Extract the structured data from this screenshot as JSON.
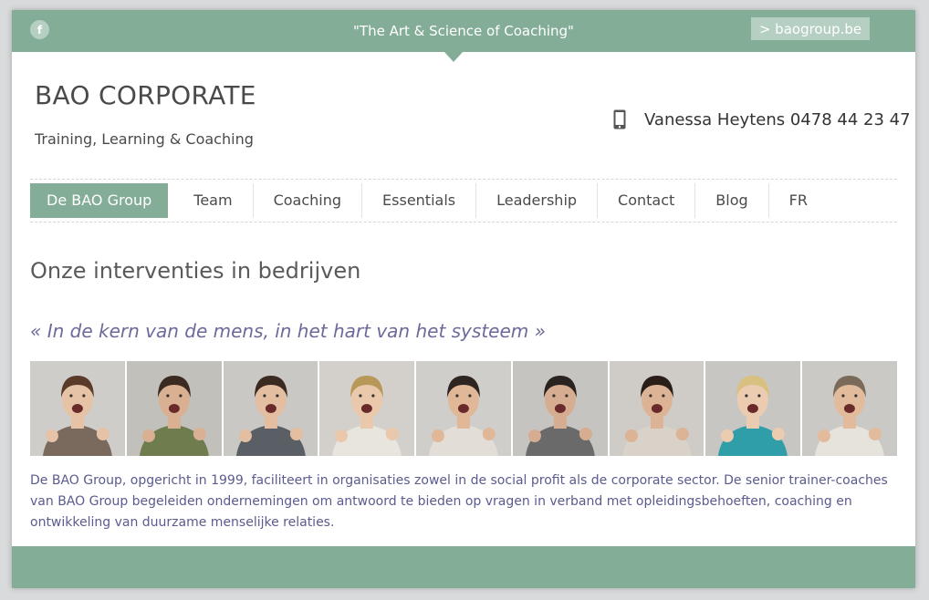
{
  "topbar": {
    "social_icon": "facebook-icon",
    "social_letter": "f",
    "tagline": "\"The Art & Science of Coaching\"",
    "external_link": "> baogroup.be"
  },
  "header": {
    "brand": "BAO CORPORATE",
    "subtitle": "Training, Learning & Coaching",
    "phone_icon": "mobile-phone-icon",
    "contact": "Vanessa Heytens 0478 44 23 47"
  },
  "nav": {
    "items": [
      {
        "label": "De BAO Group",
        "active": true
      },
      {
        "label": "Team"
      },
      {
        "label": "Coaching"
      },
      {
        "label": "Essentials"
      },
      {
        "label": "Leadership"
      },
      {
        "label": "Contact"
      },
      {
        "label": "Blog"
      },
      {
        "label": "FR"
      }
    ]
  },
  "main": {
    "heading": "Onze interventies in bedrijven",
    "quote": "« In de kern van de mens, in het hart van het systeem »",
    "photos": [
      {
        "shirt": "#7a6a5e",
        "hair": "#5a3a28",
        "bg": "#cfcdca"
      },
      {
        "shirt": "#6e7c4e",
        "hair": "#3a2a22",
        "bg": "#c2c0bb"
      },
      {
        "shirt": "#5a5f66",
        "hair": "#3a2a20",
        "bg": "#cac8c4"
      },
      {
        "shirt": "#e8e4de",
        "hair": "#b89858",
        "bg": "#d3d0cb"
      },
      {
        "shirt": "#e2ddd6",
        "hair": "#2e2420",
        "bg": "#d0ceca"
      },
      {
        "shirt": "#6a6a6a",
        "hair": "#2a2420",
        "bg": "#c6c4c0"
      },
      {
        "shirt": "#d8d2c8",
        "hair": "#2a1e18",
        "bg": "#cfccc8"
      },
      {
        "shirt": "#2f9ea8",
        "hair": "#d8c080",
        "bg": "#c8c6c2"
      },
      {
        "shirt": "#e6e2dc",
        "hair": "#7a6a5a",
        "bg": "#cbc9c5"
      }
    ],
    "description": "De BAO Group, opgericht in 1999, faciliteert in organisaties zowel in de social profit als de corporate sector. De senior trainer-coaches van BAO Group begeleiden ondernemingen om antwoord te bieden op vragen in verband met opleidingsbehoeften, coaching en ontwikkeling van duurzame menselijke relaties."
  },
  "colors": {
    "accent": "#84ad98",
    "accent_light": "#b5cfc2",
    "quote": "#6c6a9a",
    "body_text": "#5a5b8f"
  }
}
